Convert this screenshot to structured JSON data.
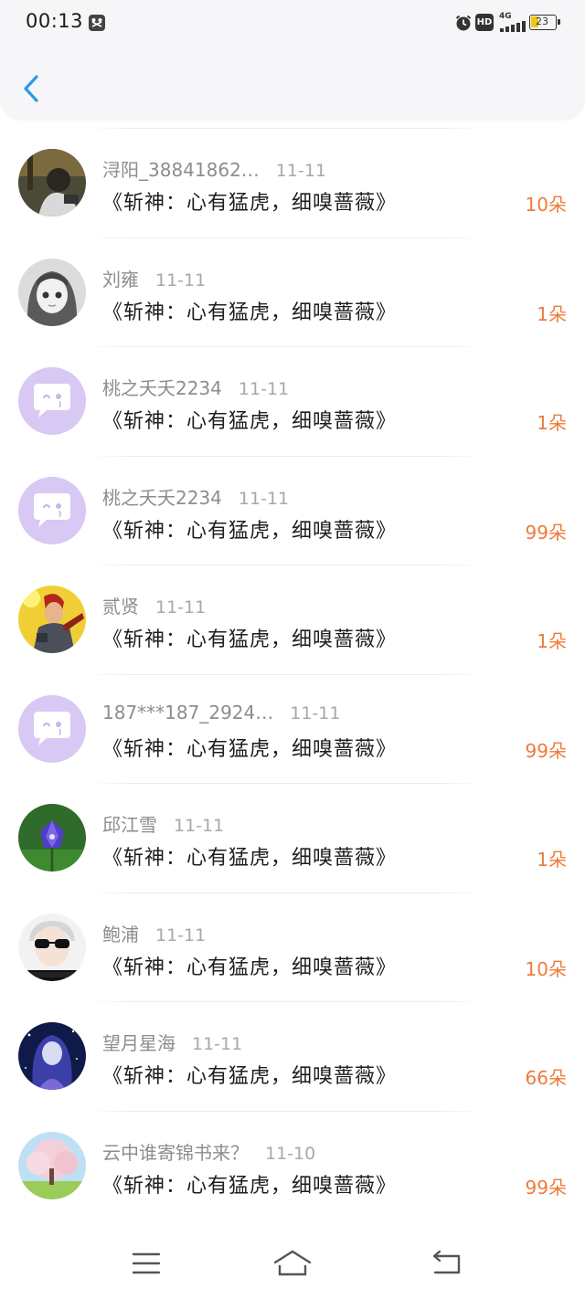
{
  "status_bar": {
    "time": "00:13",
    "battery": "23",
    "network": "4G",
    "hd": "HD"
  },
  "header": {
    "back_icon": "chevron-left-icon"
  },
  "colors": {
    "accent_blue": "#2a9be8",
    "flower_orange": "#ee7b3a",
    "default_avatar": "#d7c8f4"
  },
  "items": [
    {
      "name": "浔阳_38841862…",
      "date": "11-11",
      "title": "《斩神：心有猛虎，细嗅蔷薇》",
      "flowers": "10朵",
      "avatar": "photo-boy-dark"
    },
    {
      "name": "刘雍",
      "date": "11-11",
      "title": "《斩神：心有猛虎，细嗅蔷薇》",
      "flowers": "1朵",
      "avatar": "anime-girl-grey"
    },
    {
      "name": "桃之夭夭2234",
      "date": "11-11",
      "title": "《斩神：心有猛虎，细嗅蔷薇》",
      "flowers": "1朵",
      "avatar": "default-chat-bubble"
    },
    {
      "name": "桃之夭夭2234",
      "date": "11-11",
      "title": "《斩神：心有猛虎，细嗅蔷薇》",
      "flowers": "99朵",
      "avatar": "default-chat-bubble"
    },
    {
      "name": "贰贤",
      "date": "11-11",
      "title": "《斩神：心有猛虎，细嗅蔷薇》",
      "flowers": "1朵",
      "avatar": "game-hero-yellow"
    },
    {
      "name": "187***187_2924…",
      "date": "11-11",
      "title": "《斩神：心有猛虎，细嗅蔷薇》",
      "flowers": "99朵",
      "avatar": "default-chat-bubble"
    },
    {
      "name": "邱江雪",
      "date": "11-11",
      "title": "《斩神：心有猛虎，细嗅蔷薇》",
      "flowers": "1朵",
      "avatar": "purple-flower"
    },
    {
      "name": "鲍浦",
      "date": "11-11",
      "title": "《斩神：心有猛虎，细嗅蔷薇》",
      "flowers": "10朵",
      "avatar": "boy-sunglasses"
    },
    {
      "name": "望月星海",
      "date": "11-11",
      "title": "《斩神：心有猛虎，细嗅蔷薇》",
      "flowers": "66朵",
      "avatar": "anime-girl-night"
    },
    {
      "name": "云中谁寄锦书来？",
      "date": "11-10",
      "title": "《斩神：心有猛虎，细嗅蔷薇》",
      "flowers": "99朵",
      "avatar": "cherry-blossom-tree"
    }
  ],
  "bottom_nav": {
    "menu": "menu-icon",
    "home": "home-icon",
    "back": "back-icon"
  }
}
